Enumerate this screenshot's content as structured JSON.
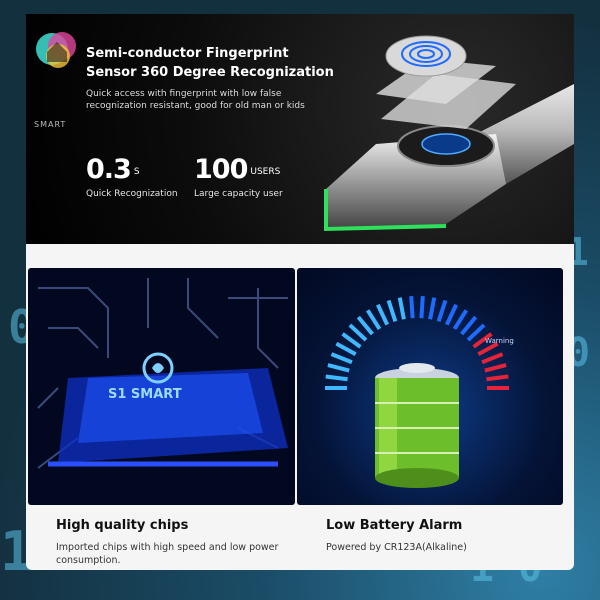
{
  "hero": {
    "title_line1": "Semi-conductor Fingerprint",
    "title_line2": "Sensor 360 Degree Recognization",
    "desc_line1": "Quick access with fingerprint with low false",
    "desc_line2": "recognization resistant, good for old man or kids",
    "stat1": {
      "value": "0.3",
      "unit": "S",
      "label": "Quick Recognization"
    },
    "stat2": {
      "value": "100",
      "unit": "USERS",
      "label": "Large capacity user"
    }
  },
  "logo_text": "SMART",
  "panel1": {
    "chip_label": "S1 SMART",
    "title": "High quality chips",
    "desc_line1": "Imported chips with high speed and low power",
    "desc_line2": "consumption."
  },
  "panel2": {
    "warning_label": "Warning",
    "title": "Low Battery Alarm",
    "desc": "Powered by CR123A(Alkaline)"
  },
  "colors": {
    "accent_blue": "#1e6bff",
    "warning_red": "#e5233a",
    "battery_green": "#7ac82a"
  }
}
